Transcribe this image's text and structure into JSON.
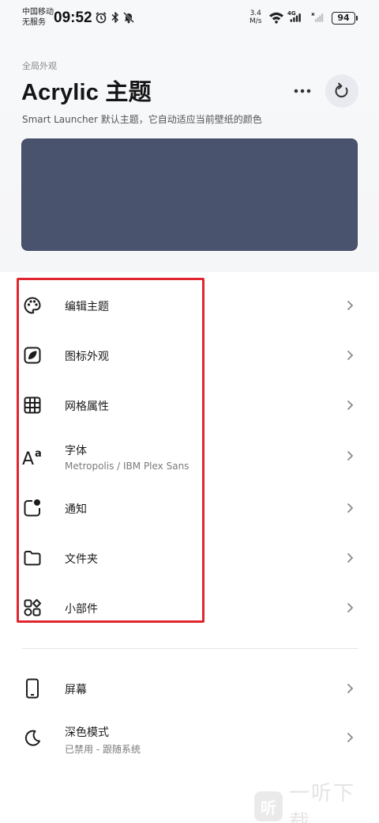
{
  "status_bar": {
    "carrier_line1": "中国移动",
    "carrier_line2": "无服务",
    "time": "09:52",
    "net_speed_value": "3.4",
    "net_speed_unit": "M/s",
    "network_type": "4G",
    "battery": "94",
    "icons": [
      "alarm-icon",
      "bluetooth-icon",
      "mute-icon",
      "wifi-icon",
      "signal-icon",
      "no-signal-icon"
    ]
  },
  "header": {
    "section_label": "全局外观",
    "title": "Acrylic 主题",
    "description": "Smart Launcher 默认主题，它自动适应当前壁纸的颜色",
    "more_icon": "more-dots-icon",
    "reset_icon": "refresh-icon",
    "preview_color": "#49536e"
  },
  "menu": {
    "items": [
      {
        "label": "编辑主题",
        "sub": "",
        "icon": "palette-icon"
      },
      {
        "label": "图标外观",
        "sub": "",
        "icon": "icon-shape-icon"
      },
      {
        "label": "网格属性",
        "sub": "",
        "icon": "grid-icon"
      },
      {
        "label": "字体",
        "sub": "Metropolis / IBM Plex Sans",
        "icon": "font-icon"
      },
      {
        "label": "通知",
        "sub": "",
        "icon": "notification-dot-icon"
      },
      {
        "label": "文件夹",
        "sub": "",
        "icon": "folder-icon"
      },
      {
        "label": "小部件",
        "sub": "",
        "icon": "widgets-icon"
      }
    ],
    "items2": [
      {
        "label": "屏幕",
        "sub": "",
        "icon": "phone-screen-icon"
      },
      {
        "label": "深色模式",
        "sub": "已禁用 - 跟随系统",
        "icon": "moon-icon"
      }
    ]
  },
  "accent_highlight": "#e0262e",
  "watermark": {
    "logo_char": "听",
    "text": "一听下载"
  }
}
